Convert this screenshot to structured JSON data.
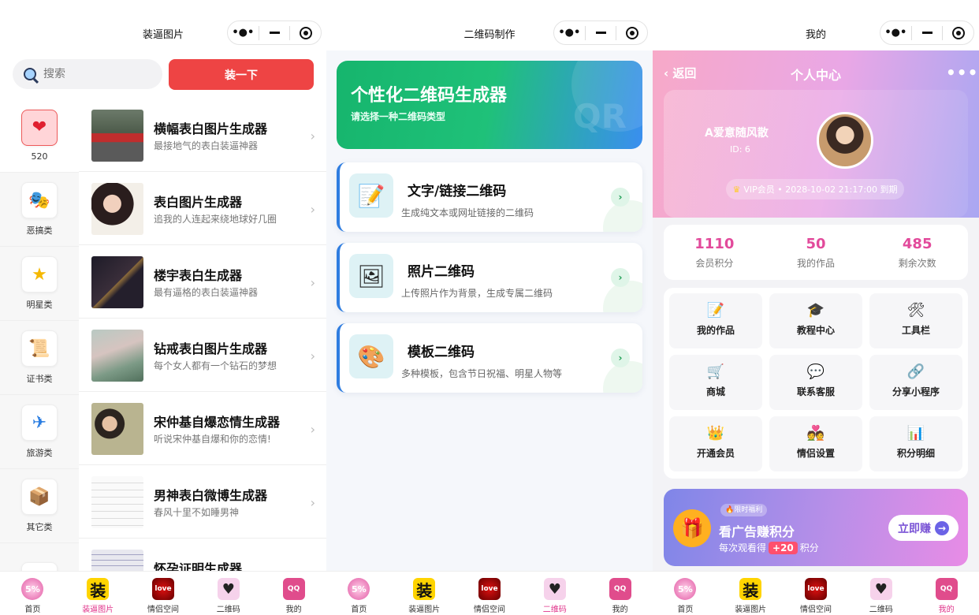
{
  "panel1": {
    "title": "装逼图片",
    "search_placeholder": "搜索",
    "action_button": "装一下",
    "categories": [
      {
        "label": "520",
        "icon": "heart-icon"
      },
      {
        "label": "恶搞类",
        "icon": "mask-icon"
      },
      {
        "label": "明星类",
        "icon": "star-icon"
      },
      {
        "label": "证书类",
        "icon": "scroll-icon"
      },
      {
        "label": "旅游类",
        "icon": "plane-icon"
      },
      {
        "label": "其它类",
        "icon": "box-icon"
      }
    ],
    "items": [
      {
        "title": "横幅表白图片生成器",
        "subtitle": "最接地气的表白装逼神器"
      },
      {
        "title": "表白图片生成器",
        "subtitle": "追我的人连起来绕地球好几圈"
      },
      {
        "title": "楼宇表白生成器",
        "subtitle": "最有逼格的表白装逼神器"
      },
      {
        "title": "钻戒表白图片生成器",
        "subtitle": "每个女人都有一个钻石的梦想"
      },
      {
        "title": "宋仲基自爆恋情生成器",
        "subtitle": "听说宋仲基自爆和你的恋情!"
      },
      {
        "title": "男神表白微博生成器",
        "subtitle": "春风十里不如睡男神"
      },
      {
        "title": "怀孕证明生成器",
        "subtitle": ""
      }
    ]
  },
  "panel2": {
    "title": "二维码制作",
    "hero_title": "个性化二维码生成器",
    "hero_subtitle": "请选择一种二维码类型",
    "hero_watermark": "QR",
    "cards": [
      {
        "title": "文字/链接二维码",
        "subtitle": "生成纯文本或网址链接的二维码",
        "icon": "memo-icon"
      },
      {
        "title": "照片二维码",
        "subtitle": "上传照片作为背景，生成专属二维码",
        "icon": "picture-icon"
      },
      {
        "title": "模板二维码",
        "subtitle": "多种模板，包含节日祝福、明星人物等",
        "icon": "palette-icon"
      }
    ]
  },
  "panel3": {
    "title": "我的",
    "back": "返回",
    "page_title": "个人中心",
    "more": "•••",
    "username": "A爱意随风散",
    "user_id": "ID: 6",
    "vip": "VIP会员 • 2028-10-02 21:17:00 到期",
    "stats": [
      {
        "value": "1110",
        "label": "会员积分"
      },
      {
        "value": "50",
        "label": "我的作品"
      },
      {
        "value": "485",
        "label": "剩余次数"
      }
    ],
    "menu": [
      {
        "label": "我的作品",
        "icon": "memo-icon"
      },
      {
        "label": "教程中心",
        "icon": "graduation-cap-icon"
      },
      {
        "label": "工具栏",
        "icon": "tools-icon"
      },
      {
        "label": "商城",
        "icon": "cart-icon"
      },
      {
        "label": "联系客服",
        "icon": "chat-icon"
      },
      {
        "label": "分享小程序",
        "icon": "link-icon"
      },
      {
        "label": "开通会员",
        "icon": "crown-icon"
      },
      {
        "label": "情侣设置",
        "icon": "couple-icon"
      },
      {
        "label": "积分明细",
        "icon": "bar-chart-icon"
      }
    ],
    "ad": {
      "tag": "限时福利",
      "title": "看广告赚积分",
      "sub_before": "每次观看得",
      "bonus": "+20",
      "sub_after": "积分",
      "button": "立即赚"
    }
  },
  "tabbar": {
    "labels": [
      "首页",
      "装逼图片",
      "情侣空间",
      "二维码",
      "我的"
    ],
    "home_icon_text": "5%",
    "zb_icon_text": "装",
    "love_icon_text": "love",
    "qr_icon_text": "♥",
    "me_icon_text": "QQ"
  },
  "colors": {
    "accent_pink": "#e24a9b",
    "button_red": "#ee4444",
    "hero_green": "#16b56d",
    "hero_blue": "#3a8ef0"
  }
}
